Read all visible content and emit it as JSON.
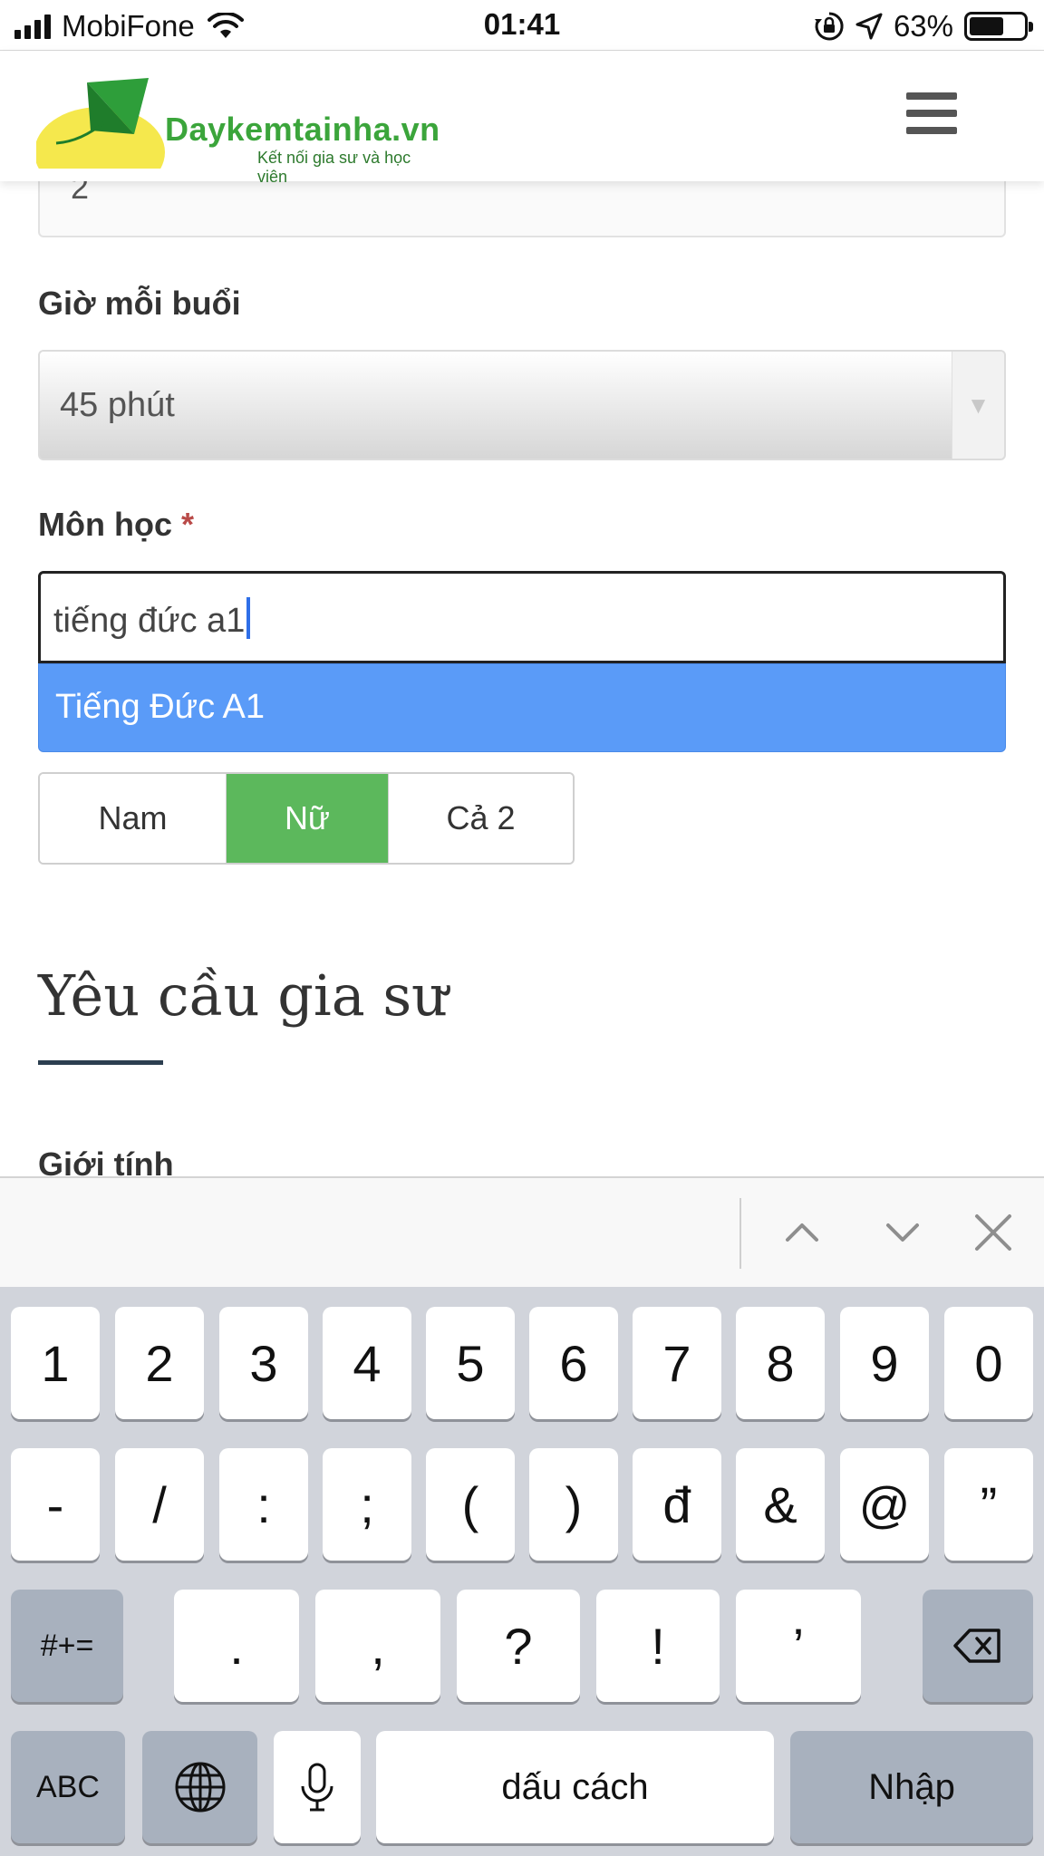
{
  "status_bar": {
    "carrier": "MobiFone",
    "time": "01:41",
    "battery_percent": "63%",
    "battery_level": 0.63,
    "icons": [
      "signal-icon",
      "wifi-icon",
      "rotation-lock-icon",
      "location-arrow-icon",
      "battery-icon"
    ]
  },
  "header": {
    "logo_title": "Daykemtainha.vn",
    "logo_subtitle": "Kết nối gia sư và học viên",
    "menu_icon": "hamburger-menu-icon"
  },
  "form": {
    "previous_field_value": "2",
    "session_hours": {
      "label": "Giờ mỗi buổi",
      "value": "45 phút"
    },
    "subject": {
      "label": "Môn học",
      "required_mark": "*",
      "value": "tiếng đức a1",
      "suggestion": "Tiếng Đức A1"
    },
    "gender_options": [
      "Nam",
      "Nữ",
      "Cả 2"
    ],
    "gender_selected": "Nữ",
    "section_title": "Yêu cầu gia sư",
    "next_label": "Giới tính"
  },
  "accessory_bar": {
    "icons": [
      "chevron-up-icon",
      "chevron-down-icon",
      "close-icon"
    ]
  },
  "keyboard": {
    "row1": [
      "1",
      "2",
      "3",
      "4",
      "5",
      "6",
      "7",
      "8",
      "9",
      "0"
    ],
    "row2": [
      "-",
      "/",
      ":",
      ";",
      "(",
      ")",
      "đ",
      "&",
      "@",
      "”"
    ],
    "row3": [
      "#+=",
      ".",
      ",",
      "?",
      "!",
      "’"
    ],
    "abc": "ABC",
    "space": "dấu cách",
    "return": "Nhập",
    "icons": [
      "globe-icon",
      "microphone-icon",
      "backspace-icon"
    ]
  },
  "colors": {
    "brand_green": "#3ba53b",
    "selected_green": "#5cb85c",
    "suggestion_blue": "#5a9bf8",
    "required_red": "#b94a48"
  }
}
